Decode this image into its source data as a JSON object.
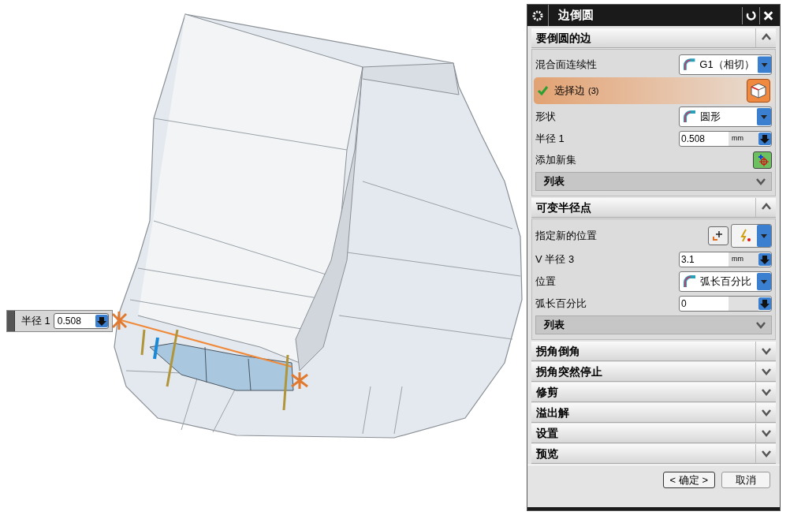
{
  "viewport": {
    "radius_box": {
      "label": "半径 1",
      "value": "0.508"
    }
  },
  "dialog": {
    "title": "边倒圆",
    "sections": [
      {
        "title": "要倒圆的边",
        "expanded": true,
        "rows": [
          {
            "kind": "dropdown",
            "label": "混合面连续性",
            "value": "G1（相切）"
          },
          {
            "kind": "selection",
            "label": "选择边",
            "count": "(3)",
            "checked": true
          },
          {
            "kind": "dropdown",
            "label": "形状",
            "value": "圆形"
          },
          {
            "kind": "number",
            "label": "半径 1",
            "value": "0.508",
            "unit": "mm"
          },
          {
            "kind": "action",
            "label": "添加新集"
          },
          {
            "kind": "list",
            "title": "列表",
            "expanded": false
          }
        ]
      },
      {
        "title": "可变半径点",
        "expanded": true,
        "rows": [
          {
            "kind": "point",
            "label": "指定新的位置"
          },
          {
            "kind": "number",
            "label": "V 半径 3",
            "value": "3.1",
            "unit": "mm"
          },
          {
            "kind": "dropdown",
            "label": "位置",
            "value": "弧长百分比"
          },
          {
            "kind": "number",
            "label": "弧长百分比",
            "value": "0"
          },
          {
            "kind": "list",
            "title": "列表",
            "expanded": false
          }
        ]
      },
      {
        "title": "拐角倒角",
        "expanded": false
      },
      {
        "title": "拐角突然停止",
        "expanded": false
      },
      {
        "title": "修剪",
        "expanded": false
      },
      {
        "title": "溢出解",
        "expanded": false
      },
      {
        "title": "设置",
        "expanded": false
      },
      {
        "title": "预览",
        "expanded": false
      }
    ],
    "buttons": [
      "< 确定 >",
      "取消"
    ]
  }
}
